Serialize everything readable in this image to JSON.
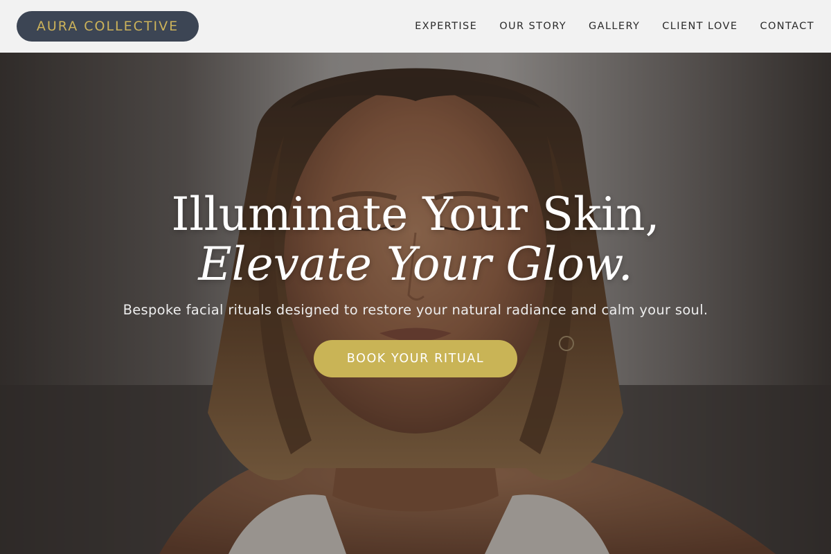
{
  "header": {
    "logo_text": "AURA COLLECTIVE",
    "nav": [
      {
        "label": "EXPERTISE"
      },
      {
        "label": "OUR STORY"
      },
      {
        "label": "GALLERY"
      },
      {
        "label": "CLIENT LOVE"
      },
      {
        "label": "CONTACT"
      }
    ]
  },
  "hero": {
    "headline_line1": "Illuminate Your Skin,",
    "headline_line2": "Elevate Your Glow.",
    "subheadline": "Bespoke facial rituals designed to restore your natural radiance and calm your soul.",
    "cta_label": "BOOK YOUR RITUAL",
    "background_image": "portrait-photo"
  },
  "colors": {
    "header_bg": "#f2f2f2",
    "logo_bg": "#3c4554",
    "logo_text": "#cdb35a",
    "accent_gold": "#c9b456",
    "nav_text": "#2a2a2a"
  }
}
